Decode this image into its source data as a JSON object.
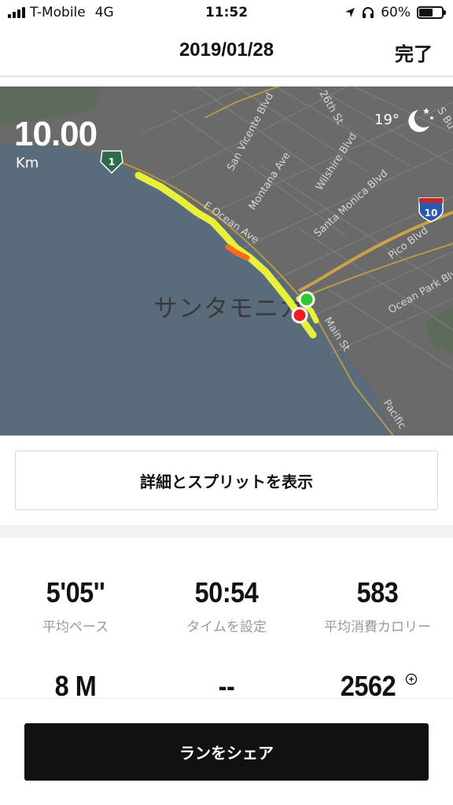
{
  "status_bar": {
    "carrier": "T-Mobile",
    "network": "4G",
    "time": "11:52",
    "battery": "60%",
    "battery_level": 0.6
  },
  "header": {
    "title": "2019/01/28",
    "done_label": "完了"
  },
  "map": {
    "distance_value": "10.00",
    "distance_unit": "Km",
    "temperature": "19°",
    "weather_icon": "moon-stars-icon",
    "area_label": "サンタモニカ",
    "road_labels": [
      "San Vicente Blvd",
      "26th St",
      "S Bu",
      "Montana Ave",
      "Wilshire Blvd",
      "Santa Monica Blvd",
      "E Ocean Ave",
      "Pico Blvd",
      "Ocean Park Blv",
      "Main St",
      "Pacific"
    ],
    "shield_1": "1",
    "shield_10": "10"
  },
  "details_button": "詳細とスプリットを表示",
  "stats": [
    {
      "value": "5'05''",
      "label": "平均ペース"
    },
    {
      "value": "50:54",
      "label": "タイムを設定"
    },
    {
      "value": "583",
      "label": "平均消費カロリー"
    },
    {
      "value": "8 M",
      "label": ""
    },
    {
      "value": "--",
      "label": ""
    },
    {
      "value": "2562",
      "label": ""
    }
  ],
  "share_button": "ランをシェア",
  "colors": {
    "route": "#e8f03a",
    "route_hot": "#ff6a1a",
    "start_marker": "#2ec82e",
    "end_marker": "#ee1c1c",
    "ocean": "#5b6e7e",
    "land": "#6b6b6b",
    "share_bg": "#111111"
  }
}
